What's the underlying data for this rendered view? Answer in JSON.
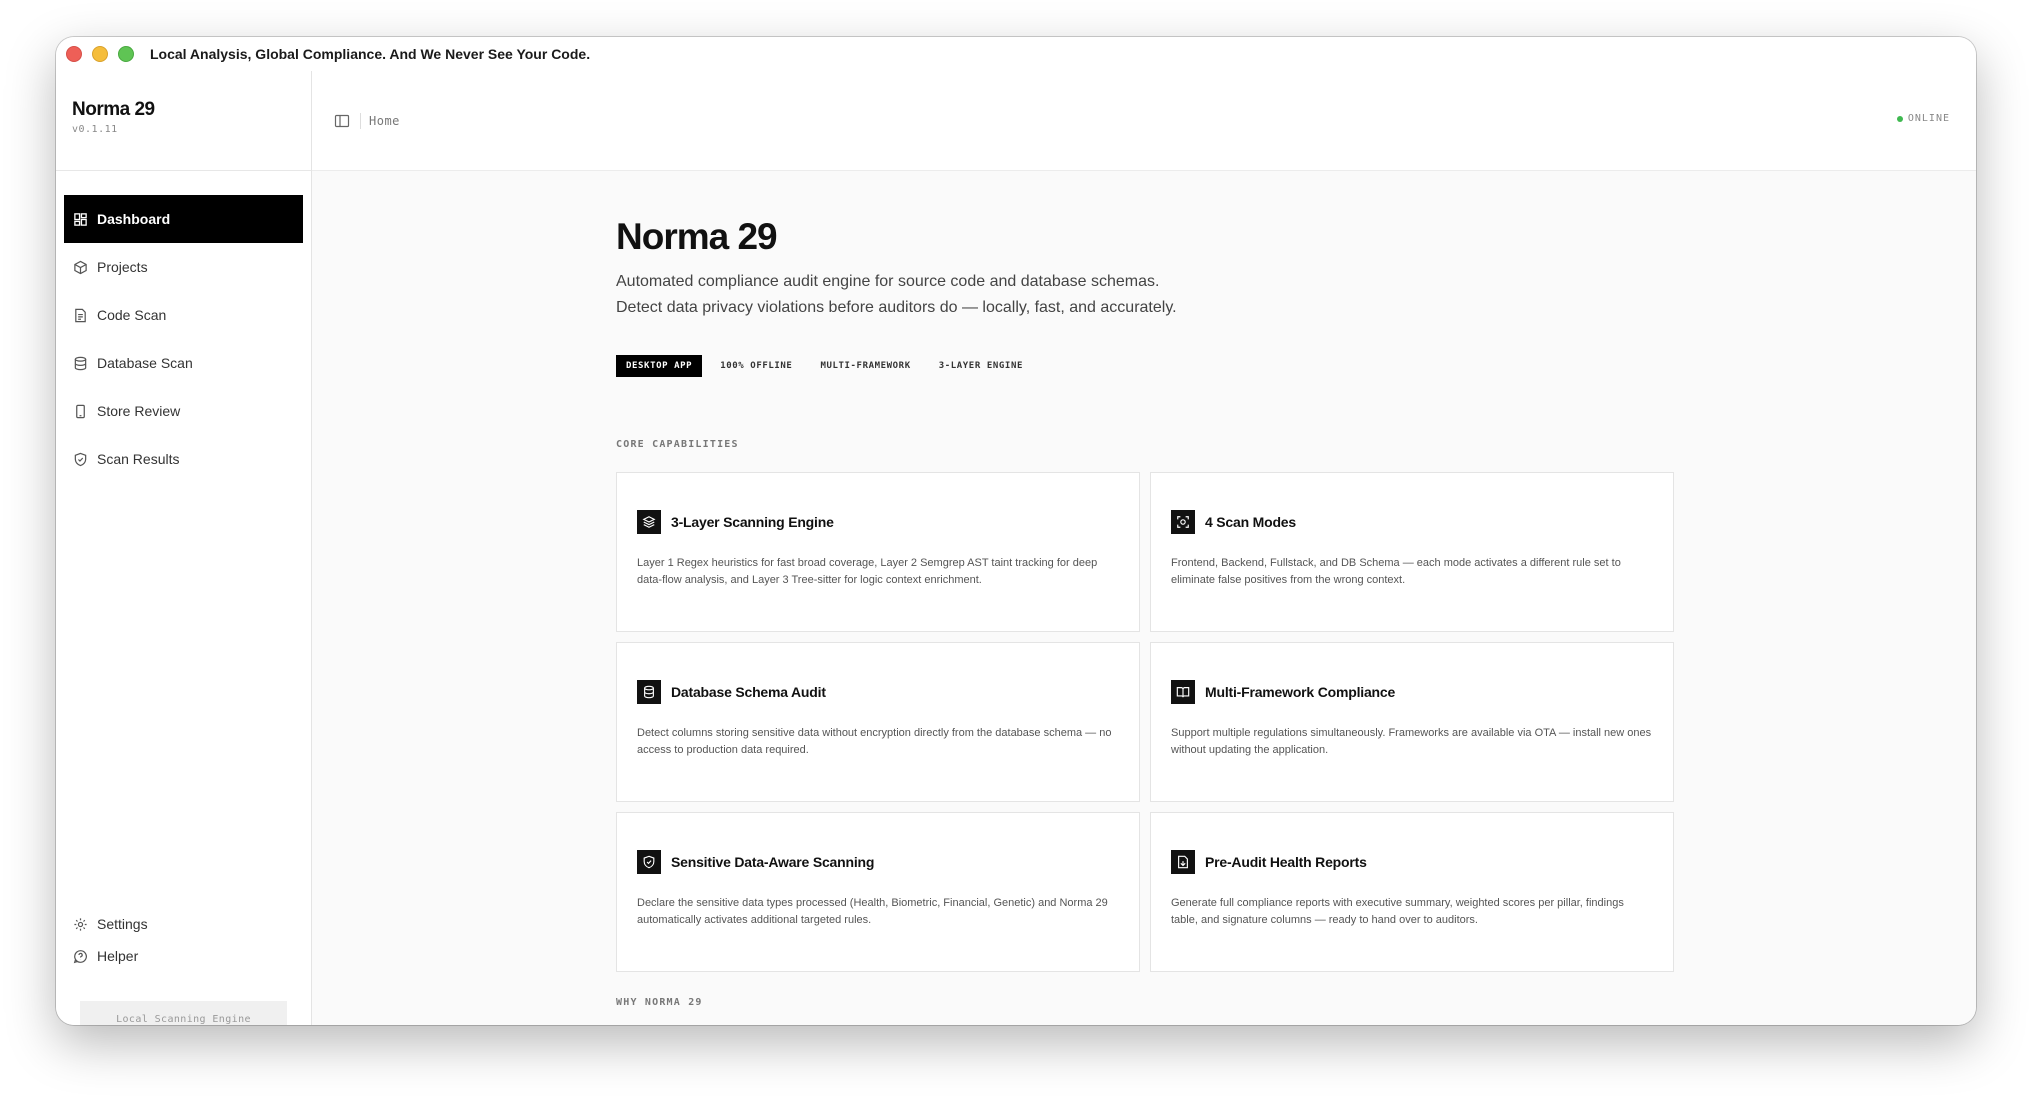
{
  "window": {
    "title": "Local Analysis, Global Compliance. And We Never See Your Code."
  },
  "sidebar": {
    "app_name": "Norma 29",
    "version": "v0.1.11",
    "items": [
      {
        "label": "Dashboard",
        "icon": "dashboard-icon",
        "active": true
      },
      {
        "label": "Projects",
        "icon": "cube-icon"
      },
      {
        "label": "Code Scan",
        "icon": "file-code-icon"
      },
      {
        "label": "Database Scan",
        "icon": "database-icon"
      },
      {
        "label": "Store Review",
        "icon": "phone-icon"
      },
      {
        "label": "Scan Results",
        "icon": "shield-icon"
      }
    ],
    "bottom_items": [
      {
        "label": "Settings",
        "icon": "gear-icon"
      },
      {
        "label": "Helper",
        "icon": "help-icon"
      }
    ],
    "engine_button": "Local Scanning Engine"
  },
  "topbar": {
    "breadcrumb": "Home",
    "status": "ONLINE"
  },
  "main": {
    "title": "Norma 29",
    "subtitle": "Automated compliance audit engine for source code and database schemas. Detect data privacy violations before auditors do — locally, fast, and accurately.",
    "badges": [
      "DESKTOP APP",
      "100% OFFLINE",
      "MULTI-FRAMEWORK",
      "3-LAYER ENGINE"
    ],
    "section_core": "CORE CAPABILITIES",
    "cards": [
      {
        "icon": "layers-icon",
        "title": "3-Layer Scanning Engine",
        "desc": "Layer 1 Regex heuristics for fast broad coverage, Layer 2 Semgrep AST taint tracking for deep data-flow analysis, and Layer 3 Tree-sitter for logic context enrichment."
      },
      {
        "icon": "scan-icon",
        "title": "4 Scan Modes",
        "desc": "Frontend, Backend, Fullstack, and DB Schema — each mode activates a different rule set to eliminate false positives from the wrong context."
      },
      {
        "icon": "database-icon",
        "title": "Database Schema Audit",
        "desc": "Detect columns storing sensitive data without encryption directly from the database schema — no access to production data required."
      },
      {
        "icon": "book-icon",
        "title": "Multi-Framework Compliance",
        "desc": "Support multiple regulations simultaneously. Frameworks are available via OTA — install new ones without updating the application."
      },
      {
        "icon": "shield-check-icon",
        "title": "Sensitive Data-Aware Scanning",
        "desc": "Declare the sensitive data types processed (Health, Biometric, Financial, Genetic) and Norma 29 automatically activates additional targeted rules."
      },
      {
        "icon": "file-report-icon",
        "title": "Pre-Audit Health Reports",
        "desc": "Generate full compliance reports with executive summary, weighted scores per pillar, findings table, and signature columns — ready to hand over to auditors."
      }
    ],
    "section_why": "WHY NORMA 29"
  },
  "colors": {
    "accent": "#000000",
    "online": "#3fb950",
    "background": "#fafafa"
  }
}
